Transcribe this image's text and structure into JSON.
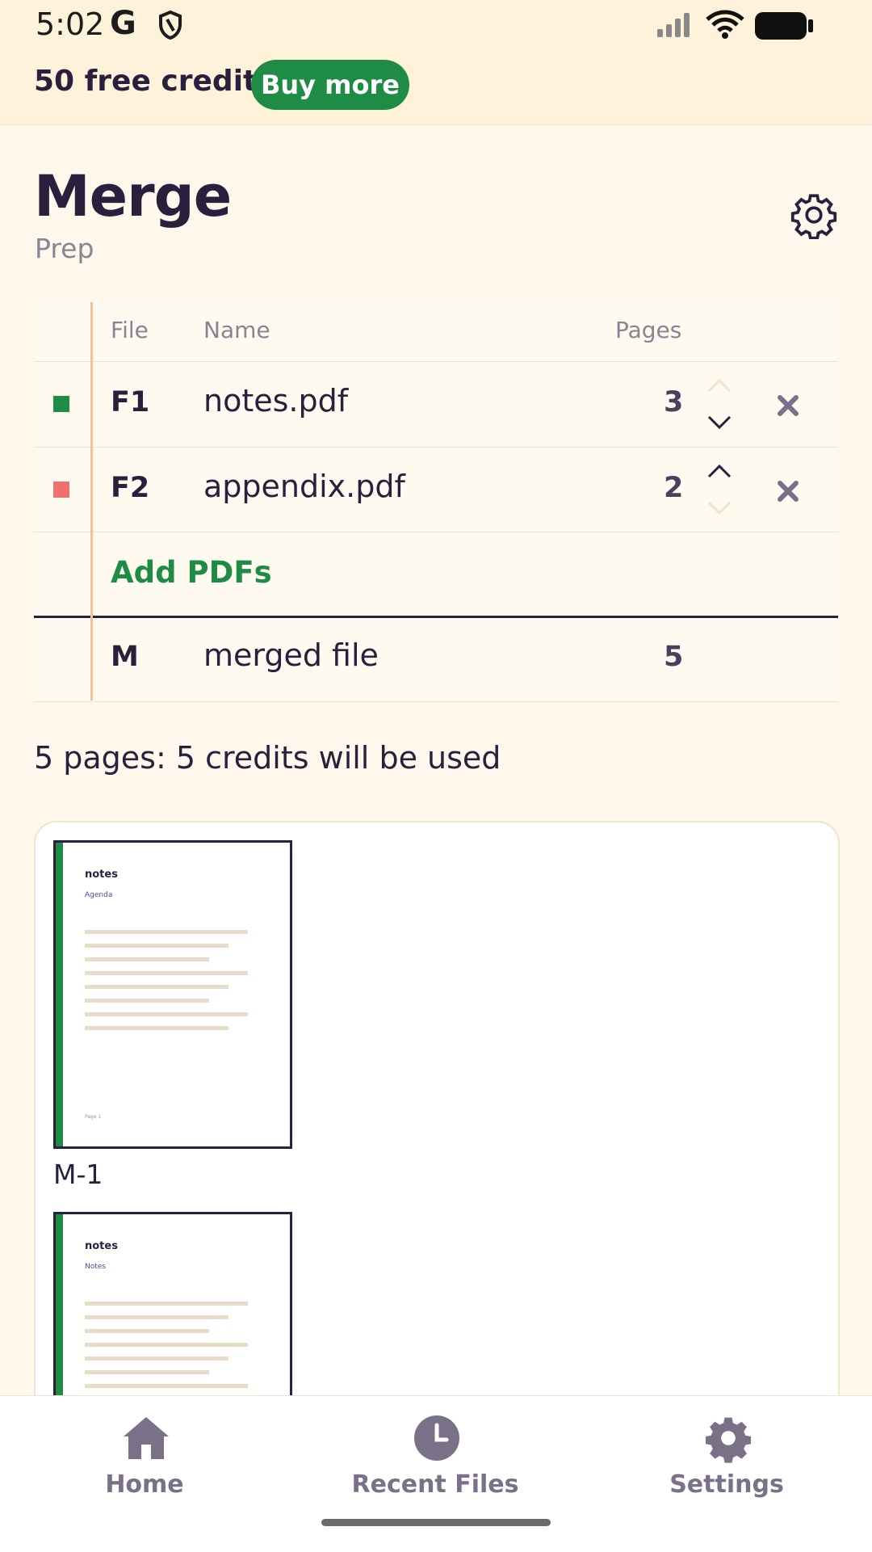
{
  "status": {
    "time": "5:02",
    "g_label": "G"
  },
  "credits": {
    "text": "50 free credits",
    "buy_label": "Buy more"
  },
  "header": {
    "title": "Merge",
    "subtitle": "Prep"
  },
  "table": {
    "headers": {
      "file": "File",
      "name": "Name",
      "pages": "Pages"
    },
    "rows": [
      {
        "id": "F1",
        "name": "notes.pdf",
        "pages": "3",
        "color": "#1F8C46"
      },
      {
        "id": "F2",
        "name": "appendix.pdf",
        "pages": "2",
        "color": "#F07070"
      }
    ],
    "add_label": "Add PDFs",
    "merged": {
      "id": "M",
      "name": "merged file",
      "pages": "5"
    }
  },
  "summary": "5 pages: 5 credits will be used",
  "preview": {
    "pages": [
      {
        "title": "notes",
        "subtitle": "Agenda",
        "footer": "Page 1",
        "label": "M-1"
      },
      {
        "title": "notes",
        "subtitle": "Notes"
      }
    ]
  },
  "nav": {
    "home": "Home",
    "recent": "Recent Files",
    "settings": "Settings"
  },
  "colors": {
    "accent": "#1F8C46",
    "background": "#FEF8EC",
    "text": "#2A1F3D"
  }
}
